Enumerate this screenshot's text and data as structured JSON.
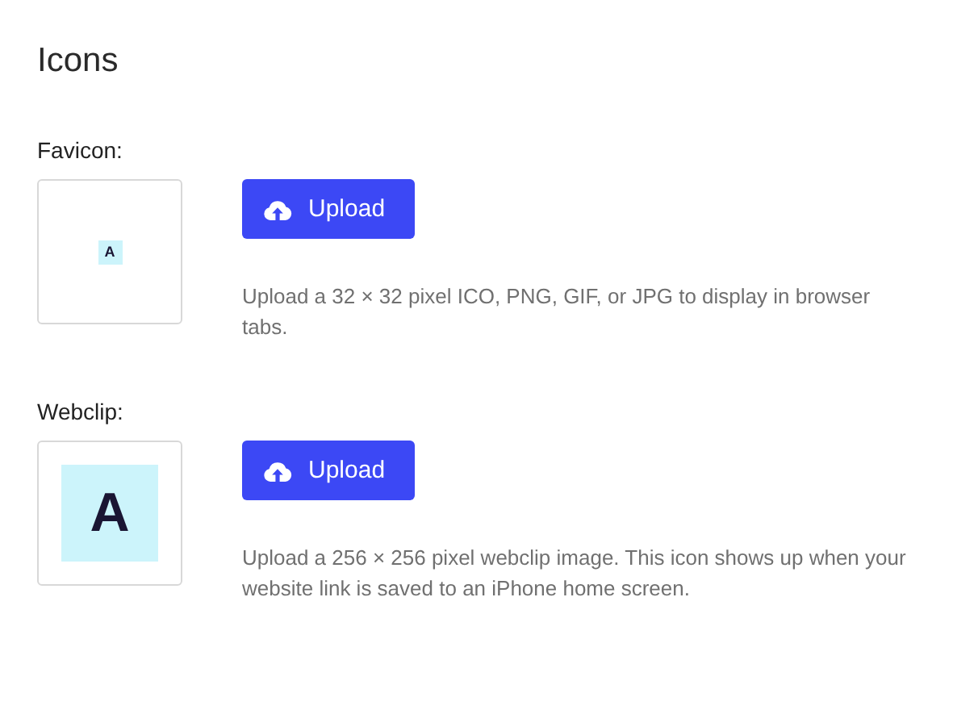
{
  "title": "Icons",
  "icons": [
    {
      "label": "Favicon:",
      "kind": "small",
      "logo_letter": "A",
      "button": "Upload",
      "description": "Upload a 32 × 32 pixel ICO, PNG, GIF, or JPG to display in browser tabs."
    },
    {
      "label": "Webclip:",
      "kind": "large",
      "logo_letter": "A",
      "button": "Upload",
      "description": "Upload a 256 × 256 pixel webclip image. This icon shows up when your website link is saved to an iPhone home screen."
    }
  ]
}
